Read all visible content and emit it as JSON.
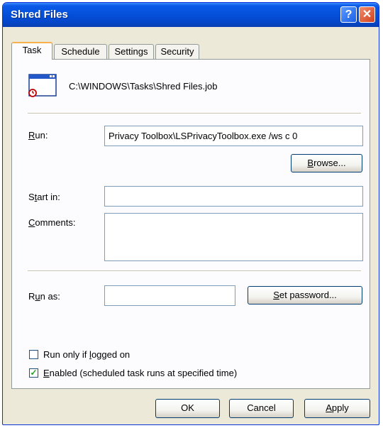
{
  "window": {
    "title": "Shred Files",
    "help_glyph": "?",
    "close_glyph": "✕"
  },
  "tabs": [
    "Task",
    "Schedule",
    "Settings",
    "Security"
  ],
  "task": {
    "path": "C:\\WINDOWS\\Tasks\\Shred Files.job",
    "run_label_key": "R",
    "run_label_rest": "un:",
    "run_value": "Privacy Toolbox\\LSPrivacyToolbox.exe /ws c 0",
    "browse_key": "B",
    "browse_rest": "rowse...",
    "startin_pre": "S",
    "startin_key": "t",
    "startin_rest": "art in:",
    "startin_value": "",
    "comments_key": "C",
    "comments_rest": "omments:",
    "comments_value": "",
    "runas_pre": "R",
    "runas_key": "u",
    "runas_rest": "n as:",
    "runas_value": "",
    "setpw_key": "S",
    "setpw_rest": "et password...",
    "runonly_pre": "Run only if ",
    "runonly_key": "l",
    "runonly_rest": "ogged on",
    "runonly_checked": false,
    "enabled_key": "E",
    "enabled_rest": "nabled (scheduled task runs at specified time)",
    "enabled_checked": true,
    "check_glyph": "✓"
  },
  "buttons": {
    "ok": "OK",
    "cancel": "Cancel",
    "apply_key": "A",
    "apply_rest": "pply"
  },
  "colors": {
    "titlebar": "#0551db",
    "face": "#ece9d8",
    "accent_tab": "#f7b04c",
    "check": "#21a121"
  }
}
